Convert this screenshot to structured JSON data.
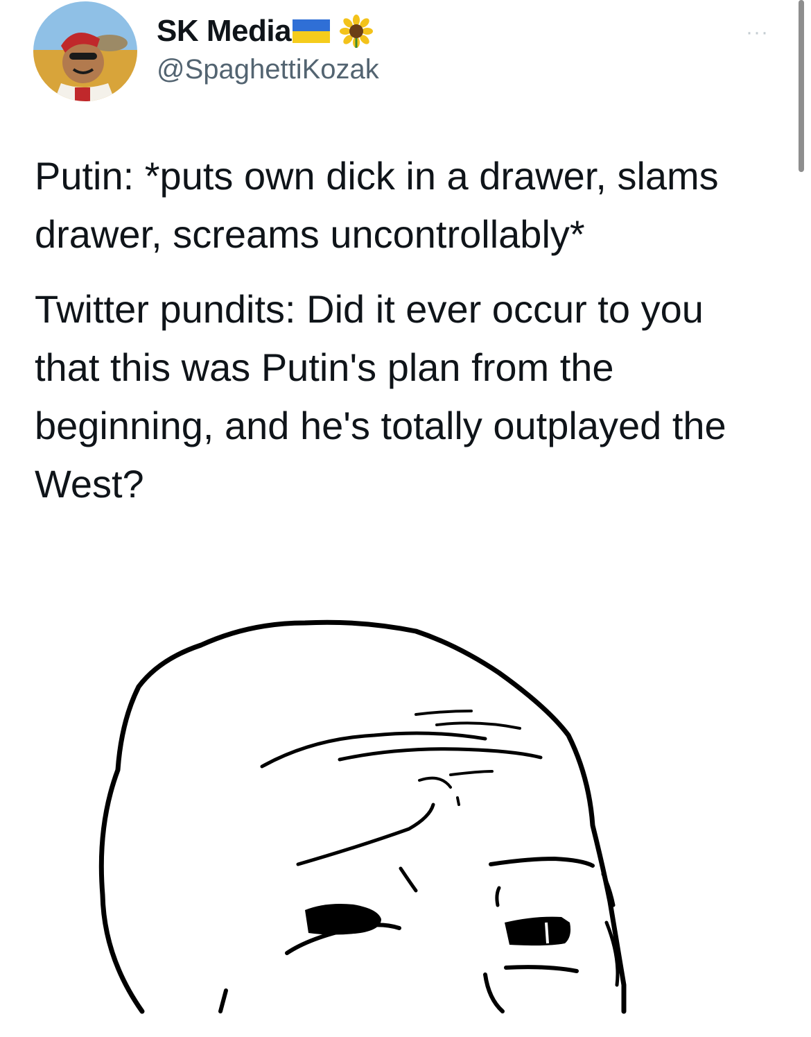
{
  "author": {
    "display_name": "SK Media",
    "handle": "@SpaghettiKozak",
    "flag_icon": "ukraine-flag-icon",
    "emoji_icon": "sunflower-icon"
  },
  "menu": {
    "more_label": "···"
  },
  "tweet": {
    "paragraphs": [
      "Putin: *puts own dick in a drawer, slams drawer, screams uncontrollably*",
      "Twitter pundits: Did it ever occur to you that this was Putin's plan from the beginning, and he's totally outplayed the West?"
    ]
  },
  "media": {
    "icon": "wojak-thinking-face-drawing"
  },
  "colors": {
    "text": "#0f1419",
    "handle": "#536471",
    "flag_blue": "#2f6fd6",
    "flag_yellow": "#f5cc1c"
  }
}
